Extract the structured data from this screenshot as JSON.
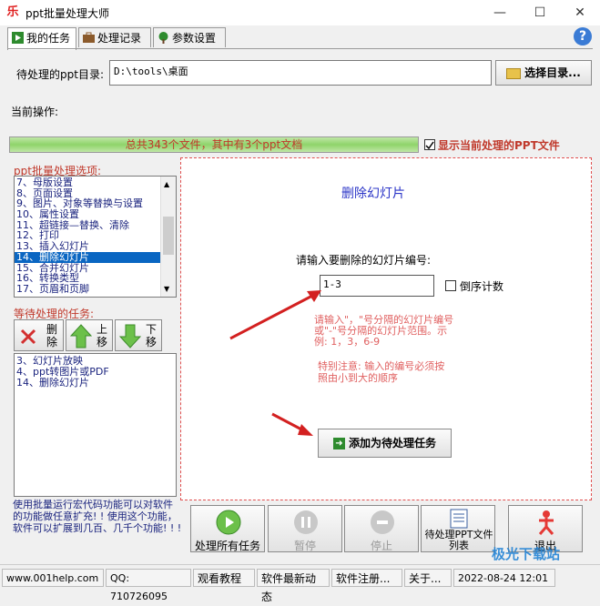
{
  "window": {
    "title": "ppt批量处理大师",
    "minimize": "—",
    "maximize": "☐",
    "close": "✕"
  },
  "tabs": [
    {
      "label": "我的任务"
    },
    {
      "label": "处理记录"
    },
    {
      "label": "参数设置"
    }
  ],
  "help_label": "?",
  "dir": {
    "label": "待处理的ppt目录:",
    "value": "D:\\tools\\桌面",
    "button": "选择目录..."
  },
  "current_op_label": "当前操作:",
  "progress": {
    "text": "总共343个文件，其中有3个ppt文档",
    "fill_fraction": 1.0,
    "show_current_label": "显示当前处理的PPT文件"
  },
  "options": {
    "title": "ppt批量处理选项:",
    "items": [
      "7、母版设置",
      "8、页面设置",
      "9、图片、对象等替换与设置",
      "10、属性设置",
      "11、超链接—替换、清除",
      "12、打印",
      "13、插入幻灯片",
      "14、删除幻灯片",
      "15、合并幻灯片",
      "16、转换类型",
      "17、页眉和页脚"
    ],
    "selected_index": 7
  },
  "pending": {
    "title": "等待处理的任务:",
    "delete": "删除",
    "up": "上移",
    "down": "下移",
    "items": [
      "3、幻灯片放映",
      "4、ppt转图片或PDF",
      "14、删除幻灯片"
    ]
  },
  "macro_note": "使用批量运行宏代码功能可以对软件的功能做任意扩充! ! 使用这个功能，软件可以扩展到几百、几千个功能! ! !",
  "panel": {
    "heading": "删除幻灯片",
    "prompt": "请输入要删除的幻灯片编号:",
    "input_value": "1-3",
    "reverse_label": "倒序计数",
    "hint": "请输入\"，\"号分隔的幻灯片编号或\"-\"号分隔的幻灯片范围。示例: 1，3，6-9",
    "note": "特别注意: 输入的编号必须按照由小到大的顺序",
    "add_button": "添加为待处理任务"
  },
  "actions": {
    "run_all": "处理所有任务",
    "pause": "暂停",
    "stop": "停止",
    "list": "待处理PPT文件列表",
    "exit": "退出"
  },
  "status": {
    "site": "www.001help.com",
    "qq": "QQ: 710726095",
    "tutorial": "观看教程",
    "news": "软件最新动态",
    "register": "软件注册...",
    "about": "关于...",
    "datetime": "2022-08-24  12:01"
  },
  "watermark": "极光下载站"
}
